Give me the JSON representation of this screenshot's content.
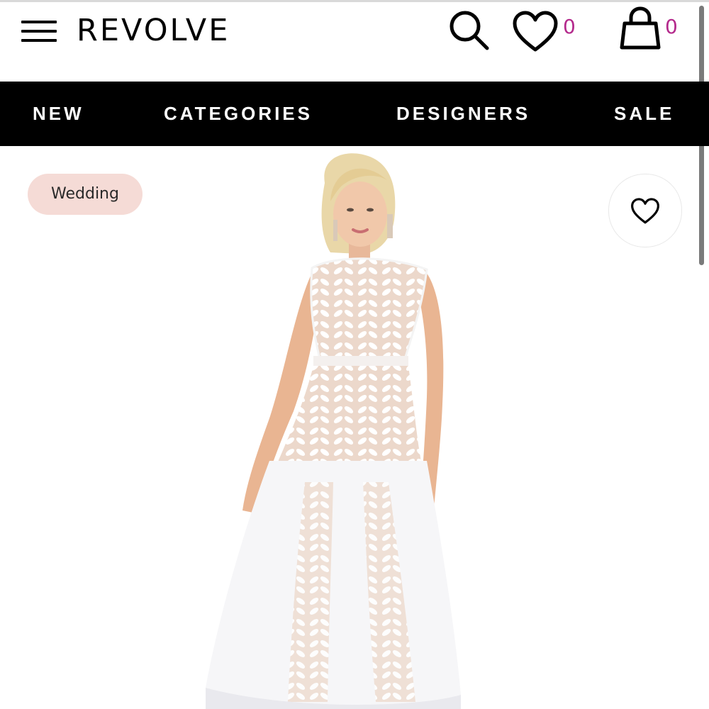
{
  "header": {
    "logo": "REVOLVE",
    "wishlist_count": "0",
    "cart_count": "0",
    "icons": [
      "menu-icon",
      "search-icon",
      "heart-icon",
      "shopping-bag-icon"
    ]
  },
  "nav": {
    "items": [
      "NEW",
      "CATEGORIES",
      "DESIGNERS",
      "SALE"
    ]
  },
  "product": {
    "tag": "Wedding",
    "favorite_icon": "heart-outline-icon"
  },
  "colors": {
    "nav_background": "#000000",
    "nav_text": "#ffffff",
    "count_accent": "#b42a8c",
    "tag_background": "#f5dbd6"
  }
}
